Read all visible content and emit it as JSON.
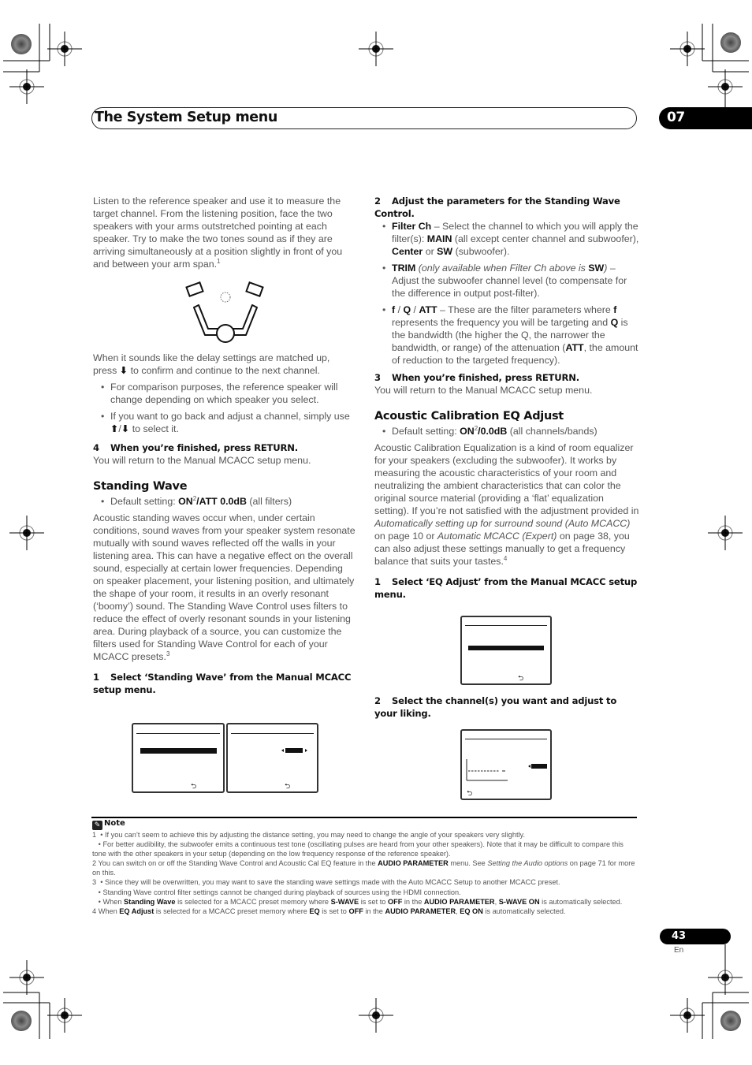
{
  "header": {
    "title": "The System Setup menu",
    "chapter": "07"
  },
  "left_column": {
    "intro_paragraph": "Listen to the reference speaker and use it to measure the target channel. From the listening position, face the two speakers with your arms outstretched pointing at each speaker. Try to make the two tones sound as if they are arriving simultaneously at a position slightly in front of you and between your arm span.",
    "intro_footnote": "1",
    "figure_label": "listener-facing-two-speakers-illustration",
    "confirm_paragraph_a": "When it sounds like the delay settings are matched up, press",
    "confirm_paragraph_b": "to confirm and continue to the next channel.",
    "down_arrow": "⬇",
    "up_arrow": "⬆",
    "bullets": [
      "For comparison purposes, the reference speaker will change depending on which speaker you select.",
      "If you want to go back and adjust a channel, simply use"
    ],
    "bullet2_tail": "to select it.",
    "step4_num": "4",
    "step4_text": "When you’re finished, press RETURN.",
    "step4_result": "You will return to the Manual MCACC setup menu.",
    "standing_wave": {
      "heading": "Standing Wave",
      "default_label": "Default setting: ",
      "default_on": "ON",
      "default_sup": "2",
      "default_value": "/ATT 0.0dB",
      "default_tail": " (all filters)",
      "paragraph": "Acoustic standing waves occur when, under certain conditions, sound waves from your speaker system resonate mutually with sound waves reflected off the walls in your listening area. This can have a negative effect on the overall sound, especially at certain lower frequencies. Depending on speaker placement, your listening position, and ultimately the shape of your room, it results in an overly resonant (‘boomy’) sound. The Standing Wave Control uses filters to reduce the effect of overly resonant sounds in your listening area. During playback of a source, you can customize the filters used for Standing Wave Control for each of your MCACC presets.",
      "paragraph_footnote": "3",
      "step1_num": "1",
      "step1_text": "Select ‘Standing Wave’ from the Manual MCACC setup menu.",
      "return_icon": "⮌"
    }
  },
  "right_column": {
    "step2_num": "2",
    "step2_text": "Adjust the parameters for the Standing Wave Control.",
    "params": [
      {
        "name": "Filter Ch",
        "sep": " – ",
        "text_a": "Select the channel to which you will apply the filter(s): ",
        "opt1": "MAIN",
        "text_b": " (all except center channel and subwoofer), ",
        "opt2": "Center",
        "text_c": " or ",
        "opt3": "SW",
        "text_d": " (subwoofer)."
      },
      {
        "name": "TRIM",
        "italic_a": " (only available when Filter Ch above is ",
        "bold_a": "SW",
        "italic_b": ")",
        "text": " – Adjust the subwoofer channel level (to compensate for the difference in output post-filter)."
      },
      {
        "name_f": "f",
        "slash1": " / ",
        "name_q": "Q",
        "slash2": " / ",
        "name_att": "ATT",
        "text_a": " – These are the filter parameters where ",
        "b_f": "f",
        "text_b": " represents the frequency you will be targeting and ",
        "b_q": "Q",
        "text_c": " is the bandwidth (the higher the Q, the narrower the bandwidth, or range) of the attenuation (",
        "b_att": "ATT",
        "text_d": ", the amount of reduction to the targeted frequency)."
      }
    ],
    "step3_num": "3",
    "step3_text": "When you’re finished, press RETURN.",
    "step3_result": "You will return to the Manual MCACC setup menu.",
    "eq_adjust": {
      "heading": "Acoustic Calibration EQ Adjust",
      "default_label": "Default setting: ",
      "default_on": "ON",
      "default_sup": "2",
      "default_value": "/0.0dB",
      "default_tail": " (all channels/bands)",
      "p_a": "Acoustic Calibration Equalization is a kind of room equalizer for your speakers (excluding the subwoofer). It works by measuring the acoustic characteristics of your room and neutralizing the ambient characteristics that can color the original source material (providing a ‘flat’ equalization setting). If you’re not satisfied with the adjustment provided in ",
      "p_link1": "Automatically setting up for surround sound (Auto MCACC)",
      "p_b": " on page 10 or ",
      "p_link2": "Automatic MCACC (Expert)",
      "p_c": " on page 38, you can also adjust these settings manually to get a frequency balance that suits your tastes.",
      "p_footnote": "4",
      "step1_num": "1",
      "step1_text": "Select ‘EQ Adjust’ from the Manual MCACC setup menu.",
      "step2_num": "2",
      "step2_text": "Select the channel(s) you want and adjust to your liking."
    }
  },
  "notes": {
    "heading": "Note",
    "n1a_num": "1",
    "n1a": "If you can’t seem to achieve this by adjusting the distance setting, you may need to change the angle of your speakers very slightly.",
    "n1b": "For better audibility, the subwoofer emits a continuous test tone (oscillating pulses are heard from your other speakers). Note that it may be difficult to compare this tone with the other speakers in your setup (depending on the low frequency response of the reference speaker).",
    "n2_num": "2",
    "n2_a": "You can switch on or off the Standing Wave Control and Acoustic Cal EQ feature in the ",
    "n2_bold": "AUDIO PARAMETER",
    "n2_b": " menu. See ",
    "n2_link": "Setting the Audio options",
    "n2_c": " on page 71 for more on this.",
    "n3_num": "3",
    "n3a": "Since they will be overwritten, you may want to save the standing wave settings made with the Auto MCACC Setup to another MCACC preset.",
    "n3b": "Standing Wave control filter settings cannot be changed during playback of sources using the HDMI connection.",
    "n3c_a": "When ",
    "n3c_b1": "Standing Wave",
    "n3c_b": " is selected for a MCACC preset memory where ",
    "n3c_b2": "S-WAVE",
    "n3c_c": " is set to ",
    "n3c_b3": "OFF",
    "n3c_d": " in the ",
    "n3c_b4": "AUDIO PARAMETER",
    "n3c_e": ", ",
    "n3c_b5": "S-WAVE ON",
    "n3c_f": " is automatically selected.",
    "n4_num": "4",
    "n4_a": "When ",
    "n4_b1": "EQ Adjust",
    "n4_b": " is selected for a MCACC preset memory where ",
    "n4_b2": "EQ",
    "n4_c": " is set to ",
    "n4_b3": "OFF",
    "n4_d": " in the ",
    "n4_b4": "AUDIO PARAMETER",
    "n4_e": ", ",
    "n4_b5": "EQ ON",
    "n4_f": " is automatically selected."
  },
  "footer": {
    "page_number": "43",
    "language": "En"
  }
}
